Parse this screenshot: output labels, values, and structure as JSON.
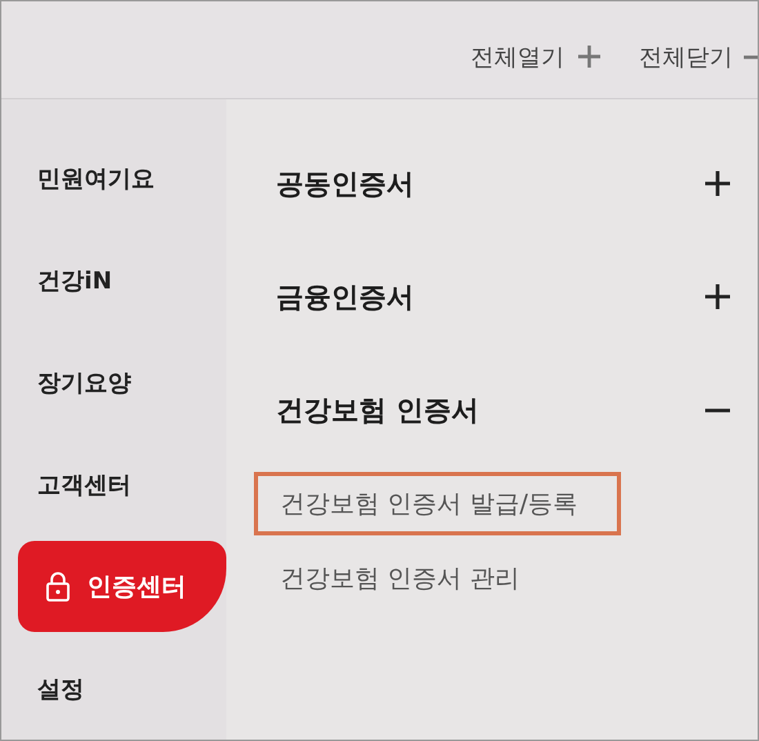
{
  "header": {
    "actions": [
      {
        "label": "전체열기",
        "kind": "expand"
      },
      {
        "label": "전체닫기",
        "kind": "collapse"
      }
    ]
  },
  "sidebar": {
    "items": [
      {
        "label": "민원여기요",
        "selected": false
      },
      {
        "label": "건강iN",
        "selected": false
      },
      {
        "label": "장기요양",
        "selected": false
      },
      {
        "label": "고객센터",
        "selected": false
      },
      {
        "label": "인증센터",
        "selected": true
      },
      {
        "label": "설정",
        "selected": false
      }
    ]
  },
  "sections": [
    {
      "title": "공동인증서",
      "expanded": false
    },
    {
      "title": "금융인증서",
      "expanded": false
    },
    {
      "title": "건강보험 인증서",
      "expanded": true,
      "items": [
        {
          "label": "건강보험 인증서 발급/등록",
          "highlighted": true
        },
        {
          "label": "건강보험 인증서 관리",
          "highlighted": false
        }
      ]
    }
  ]
}
